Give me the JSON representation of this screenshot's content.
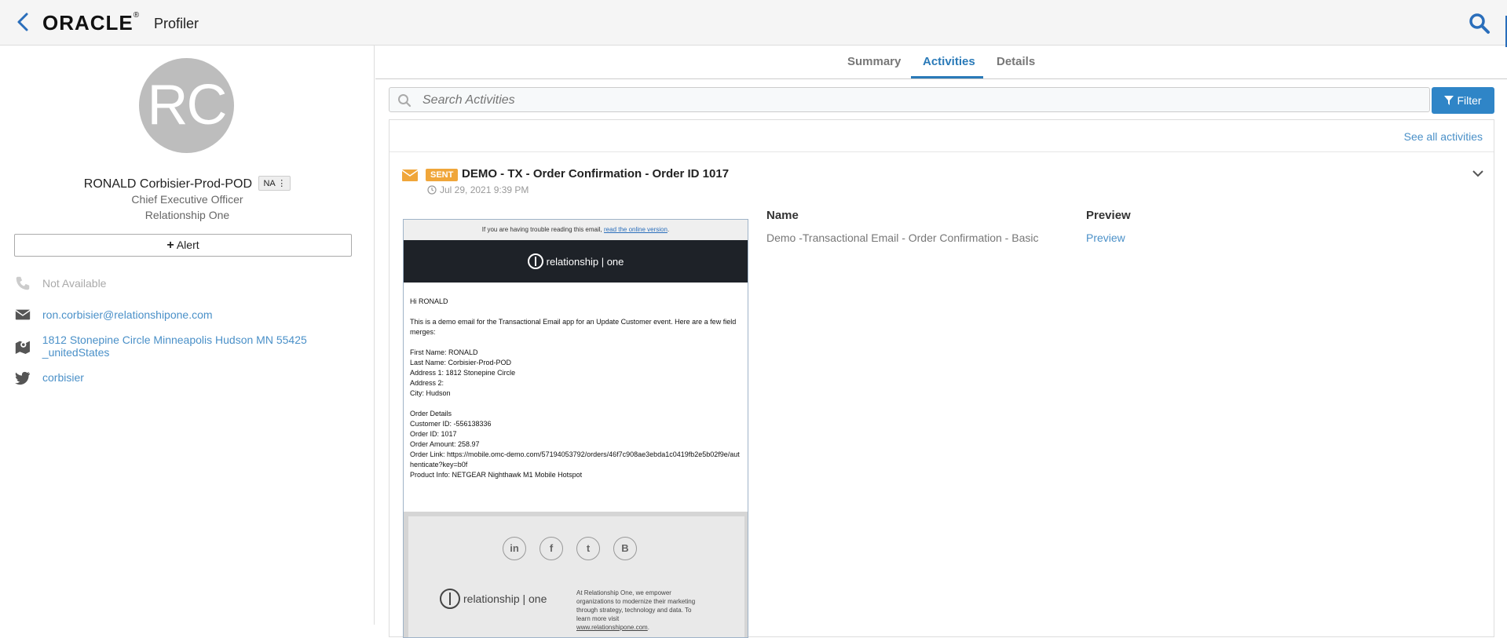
{
  "header": {
    "brand": "ORACLE",
    "brand_reg": "®",
    "product": "Profiler"
  },
  "profile": {
    "initials": "RC",
    "name": "RONALD Corbisier-Prod-POD",
    "badge": "NA",
    "title": "Chief Executive Officer",
    "company": "Relationship One",
    "alert_label": "Alert",
    "phone": "Not Available",
    "email": "ron.corbisier@relationshipone.com",
    "address": "1812 Stonepine Circle Minneapolis Hudson MN 55425 _unitedStates",
    "twitter": "corbisier"
  },
  "tabs": [
    {
      "label": "Summary"
    },
    {
      "label": "Activities"
    },
    {
      "label": "Details"
    }
  ],
  "search": {
    "placeholder": "Search Activities"
  },
  "filter_label": "Filter",
  "see_all": "See all activities",
  "activity": {
    "status": "SENT",
    "title": "DEMO - TX - Order Confirmation - Order ID 1017",
    "date": "Jul 29, 2021 9:39 PM",
    "name_header": "Name",
    "preview_header": "Preview",
    "name_value": "Demo -Transactional Email - Order Confirmation - Basic",
    "preview_value": "Preview"
  },
  "email_preview": {
    "top_text": "If you are having trouble reading this email,",
    "top_link": "read the online version",
    "top_end": ".",
    "logo_text": "relationship | one",
    "greeting": "Hi RONALD",
    "intro": "This is a demo email for the Transactional Email app for an Update Customer event. Here are a few field merges:",
    "fields": [
      "First Name: RONALD",
      "Last Name: Corbisier-Prod-POD",
      "Address 1: 1812 Stonepine Circle",
      "Address 2:",
      "City: Hudson"
    ],
    "order": [
      "Order Details",
      "Customer ID: -556138336",
      "Order ID: 1017",
      "Order Amount: 258.97",
      "Order Link: https://mobile.omc-demo.com/57194053792/orders/46f7c908ae3ebda1c0419fb2e5b02f9e/authenticate?key=b0f",
      "Product Info: NETGEAR Nighthawk M1 Mobile Hotspot"
    ],
    "social": [
      "in",
      "f",
      "t",
      "B"
    ],
    "footer_text": "At Relationship One, we empower organizations to modernize their marketing through strategy, technology and data. To learn more visit",
    "footer_link": "www.relationshipone.com",
    "footer_end": "."
  }
}
